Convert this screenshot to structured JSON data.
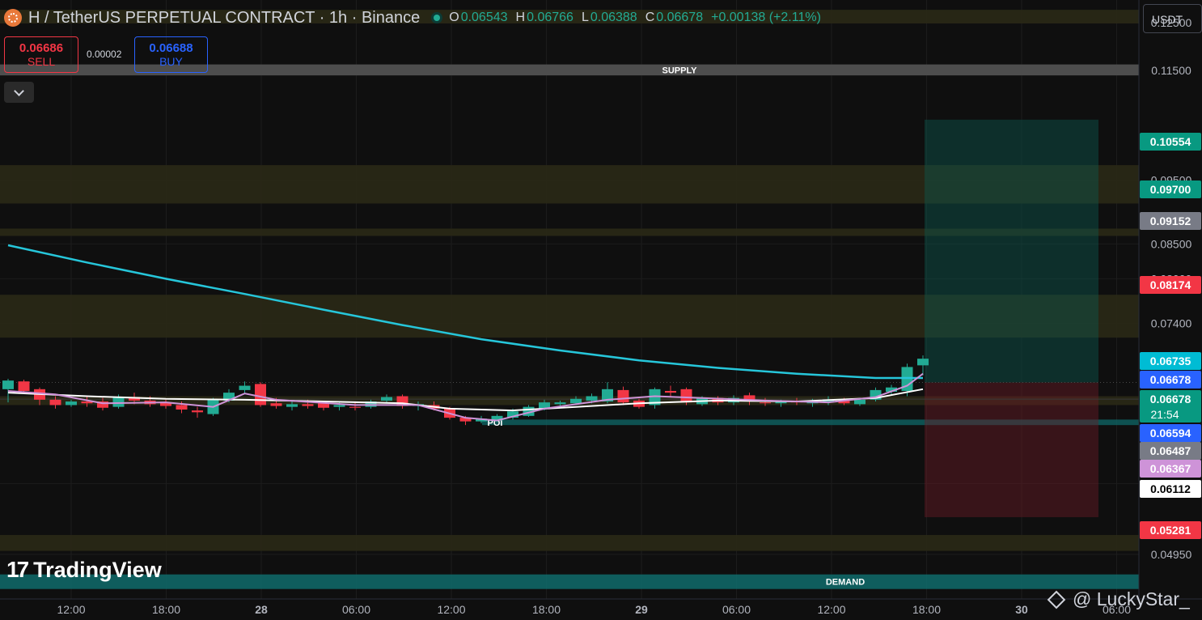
{
  "header": {
    "title": "H / TetherUS PERPETUAL CONTRACT · 1h · Binance",
    "open_label": "O",
    "open": "0.06543",
    "high_label": "H",
    "high": "0.06766",
    "low_label": "L",
    "low": "0.06388",
    "close_label": "C",
    "close": "0.06678",
    "change": "+0.00138 (+2.11%)"
  },
  "trade": {
    "sell_price": "0.06686",
    "sell_label": "SELL",
    "spread": "0.00002",
    "buy_price": "0.06688",
    "buy_label": "BUY"
  },
  "currency": "USDT",
  "branding": {
    "logo_text": "TradingView",
    "watermark": "@ LuckyStar_"
  },
  "colors": {
    "up": "#22ab94",
    "down": "#f23645",
    "ema_long": "#26c6da",
    "ma_fast": "#ce93d8",
    "ma_slow": "#ffffff",
    "zone": "#2b2a17"
  },
  "chart_data": {
    "type": "candlestick",
    "timeframe": "1h",
    "ylim": [
      0.0458,
      0.13
    ],
    "scale": "log",
    "x_ticks": [
      "12:00",
      "18:00",
      "28",
      "06:00",
      "12:00",
      "18:00",
      "29",
      "06:00",
      "12:00",
      "18:00",
      "30",
      "06:00"
    ],
    "y_ticks": [
      "0.12500",
      "0.11500",
      "0.09500",
      "0.08500",
      "0.08000",
      "0.07400",
      "0.05600",
      "0.04950"
    ],
    "price_tags": [
      {
        "label": "0.10554",
        "color": "#089981"
      },
      {
        "label": "0.09700",
        "color": "#089981"
      },
      {
        "label": "0.09152",
        "color": "#787b86"
      },
      {
        "label": "0.08174",
        "color": "#f23645"
      },
      {
        "label": "0.06735",
        "color": "#00bcd4"
      },
      {
        "label": "0.06678",
        "color": "#2962ff"
      },
      {
        "label": "0.06678",
        "sub": "21:54",
        "color": "#089981"
      },
      {
        "label": "0.06594",
        "color": "#2962ff"
      },
      {
        "label": "0.06487",
        "color": "#787b86"
      },
      {
        "label": "0.06367",
        "color": "#ce93d8"
      },
      {
        "label": "0.06112",
        "color": "#ffffff"
      },
      {
        "label": "0.05281",
        "color": "#f23645"
      }
    ],
    "zones": [
      {
        "from": 0.1248,
        "to": 0.1278,
        "kind": "zone"
      },
      {
        "from": 0.114,
        "to": 0.1162,
        "label": "SUPPLY",
        "kind": "supply"
      },
      {
        "from": 0.0912,
        "to": 0.0975,
        "kind": "zone"
      },
      {
        "from": 0.0862,
        "to": 0.0873,
        "kind": "zone"
      },
      {
        "from": 0.0722,
        "to": 0.0778,
        "kind": "zone"
      },
      {
        "from": 0.0642,
        "to": 0.0652,
        "kind": "zone"
      },
      {
        "from": 0.062,
        "to": 0.0626,
        "label": "POI",
        "kind": "poi"
      },
      {
        "from": 0.0498,
        "to": 0.0512,
        "kind": "zone"
      },
      {
        "from": 0.0466,
        "to": 0.0478,
        "label": "DEMAND",
        "kind": "demand"
      }
    ],
    "position": {
      "entry": 0.06678,
      "target": 0.10554,
      "stop": 0.05281
    },
    "candles": [
      [
        0.066,
        0.0672,
        0.0645,
        0.067
      ],
      [
        0.0669,
        0.0671,
        0.0656,
        0.0658
      ],
      [
        0.066,
        0.0662,
        0.0642,
        0.0648
      ],
      [
        0.0648,
        0.0652,
        0.0638,
        0.0642
      ],
      [
        0.0642,
        0.0648,
        0.064,
        0.0646
      ],
      [
        0.0646,
        0.0652,
        0.064,
        0.0644
      ],
      [
        0.0646,
        0.065,
        0.0636,
        0.0639
      ],
      [
        0.064,
        0.0654,
        0.0638,
        0.0651
      ],
      [
        0.0651,
        0.0656,
        0.0643,
        0.0647
      ],
      [
        0.0647,
        0.0652,
        0.064,
        0.0643
      ],
      [
        0.0645,
        0.0648,
        0.0638,
        0.0641
      ],
      [
        0.0642,
        0.0646,
        0.0633,
        0.0637
      ],
      [
        0.0636,
        0.064,
        0.0628,
        0.0634
      ],
      [
        0.0632,
        0.065,
        0.063,
        0.0648
      ],
      [
        0.0647,
        0.066,
        0.0645,
        0.0656
      ],
      [
        0.0659,
        0.0669,
        0.0655,
        0.0664
      ],
      [
        0.0666,
        0.0668,
        0.064,
        0.0642
      ],
      [
        0.0644,
        0.065,
        0.0638,
        0.0641
      ],
      [
        0.064,
        0.0646,
        0.0636,
        0.0643
      ],
      [
        0.0643,
        0.0648,
        0.0638,
        0.0641
      ],
      [
        0.0644,
        0.0647,
        0.0636,
        0.0639
      ],
      [
        0.064,
        0.0645,
        0.0636,
        0.0642
      ],
      [
        0.064,
        0.0646,
        0.0636,
        0.0639
      ],
      [
        0.064,
        0.0648,
        0.0638,
        0.0646
      ],
      [
        0.0647,
        0.0654,
        0.0644,
        0.0651
      ],
      [
        0.0652,
        0.0654,
        0.0638,
        0.0641
      ],
      [
        0.0641,
        0.0646,
        0.0636,
        0.0643
      ],
      [
        0.0642,
        0.0646,
        0.0636,
        0.0638
      ],
      [
        0.0638,
        0.064,
        0.0626,
        0.0628
      ],
      [
        0.0628,
        0.063,
        0.062,
        0.0624
      ],
      [
        0.0624,
        0.063,
        0.0622,
        0.0627
      ],
      [
        0.0625,
        0.0632,
        0.0623,
        0.063
      ],
      [
        0.0628,
        0.0638,
        0.0626,
        0.0635
      ],
      [
        0.063,
        0.0642,
        0.0629,
        0.064
      ],
      [
        0.0638,
        0.0648,
        0.0636,
        0.0645
      ],
      [
        0.0643,
        0.0647,
        0.064,
        0.0645
      ],
      [
        0.0644,
        0.0652,
        0.0642,
        0.0649
      ],
      [
        0.0647,
        0.0655,
        0.0644,
        0.0652
      ],
      [
        0.0646,
        0.0668,
        0.0644,
        0.066
      ],
      [
        0.0659,
        0.0663,
        0.0642,
        0.0645
      ],
      [
        0.0647,
        0.0649,
        0.0638,
        0.064
      ],
      [
        0.0642,
        0.0662,
        0.0638,
        0.066
      ],
      [
        0.0658,
        0.0664,
        0.0652,
        0.0656
      ],
      [
        0.066,
        0.0662,
        0.0642,
        0.0645
      ],
      [
        0.0643,
        0.0652,
        0.0641,
        0.065
      ],
      [
        0.065,
        0.0652,
        0.0642,
        0.0645
      ],
      [
        0.0645,
        0.0653,
        0.0642,
        0.065
      ],
      [
        0.0653,
        0.0656,
        0.0642,
        0.0646
      ],
      [
        0.0645,
        0.065,
        0.0641,
        0.0644
      ],
      [
        0.0644,
        0.0648,
        0.064,
        0.0646
      ],
      [
        0.0647,
        0.065,
        0.0642,
        0.0645
      ],
      [
        0.0644,
        0.0649,
        0.064,
        0.0645
      ],
      [
        0.0646,
        0.0652,
        0.0642,
        0.0648
      ],
      [
        0.0648,
        0.065,
        0.0642,
        0.0644
      ],
      [
        0.0643,
        0.065,
        0.0641,
        0.0648
      ],
      [
        0.0648,
        0.0662,
        0.0646,
        0.0659
      ],
      [
        0.0657,
        0.0665,
        0.0654,
        0.0662
      ],
      [
        0.0658,
        0.069,
        0.0652,
        0.0686
      ],
      [
        0.0688,
        0.07,
        0.0676,
        0.0696
      ]
    ],
    "series": [
      {
        "name": "EMA long",
        "color": "#26c6da",
        "points": [
          [
            0,
            0.0848
          ],
          [
            5,
            0.0823
          ],
          [
            10,
            0.08
          ],
          [
            15,
            0.0779
          ],
          [
            20,
            0.0758
          ],
          [
            25,
            0.0738
          ],
          [
            30,
            0.072
          ],
          [
            35,
            0.0706
          ],
          [
            40,
            0.0694
          ],
          [
            45,
            0.0685
          ],
          [
            50,
            0.0678
          ],
          [
            55,
            0.0673
          ],
          [
            58,
            0.0673
          ]
        ]
      },
      {
        "name": "MA slow",
        "color": "#ffffff",
        "points": [
          [
            0,
            0.0656
          ],
          [
            5,
            0.0652
          ],
          [
            10,
            0.0649
          ],
          [
            15,
            0.0648
          ],
          [
            20,
            0.0646
          ],
          [
            25,
            0.0644
          ],
          [
            28,
            0.0638
          ],
          [
            32,
            0.0636
          ],
          [
            36,
            0.064
          ],
          [
            40,
            0.0644
          ],
          [
            45,
            0.0647
          ],
          [
            50,
            0.0646
          ],
          [
            55,
            0.065
          ],
          [
            58,
            0.066
          ]
        ]
      },
      {
        "name": "MA fast",
        "color": "#ce93d8",
        "points": [
          [
            0,
            0.0658
          ],
          [
            3,
            0.0654
          ],
          [
            6,
            0.0644
          ],
          [
            10,
            0.0645
          ],
          [
            13,
            0.064
          ],
          [
            15,
            0.0655
          ],
          [
            17,
            0.0648
          ],
          [
            22,
            0.0642
          ],
          [
            26,
            0.0642
          ],
          [
            29,
            0.0628
          ],
          [
            31,
            0.0625
          ],
          [
            34,
            0.0638
          ],
          [
            38,
            0.0648
          ],
          [
            41,
            0.0652
          ],
          [
            44,
            0.065
          ],
          [
            48,
            0.0647
          ],
          [
            52,
            0.0645
          ],
          [
            55,
            0.0651
          ],
          [
            57,
            0.0664
          ],
          [
            58,
            0.0678
          ]
        ]
      }
    ]
  }
}
